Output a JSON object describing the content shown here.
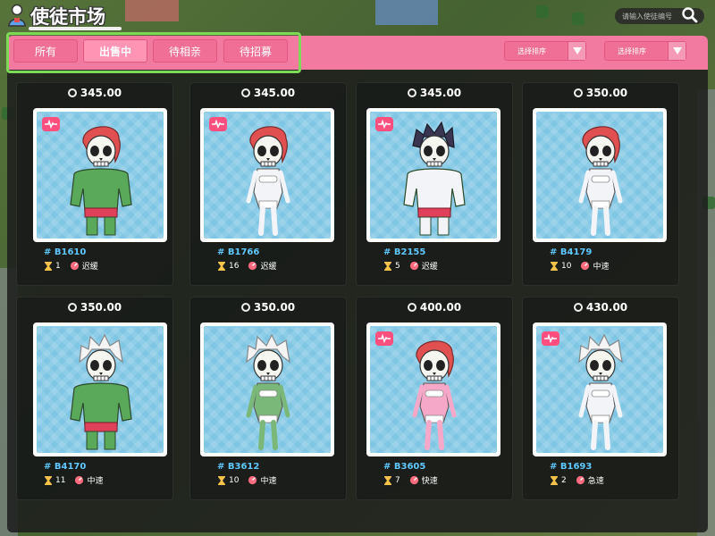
{
  "header": {
    "title": "使徒市场",
    "search_placeholder": "请输入使徒编号"
  },
  "tabs": [
    {
      "label": "所有",
      "active": false
    },
    {
      "label": "出售中",
      "active": true
    },
    {
      "label": "待相亲",
      "active": false
    },
    {
      "label": "待招募",
      "active": false
    }
  ],
  "sorts": [
    {
      "label": "选择排序"
    },
    {
      "label": "选择排序"
    }
  ],
  "colors": {
    "tab_bar": "#f27aa0",
    "selection_outline": "#7ed957",
    "id_text": "#5fc8ff",
    "heart": "#ff4f7e"
  },
  "cards": [
    {
      "price": "345.00",
      "id": "# B1610",
      "count": "1",
      "speed": "迟缓",
      "heart": true,
      "hair": "#e05050",
      "body": "#5aa85a",
      "hair_style": "red",
      "build": "muscle"
    },
    {
      "price": "345.00",
      "id": "# B1766",
      "count": "16",
      "speed": "迟缓",
      "heart": true,
      "hair": "#e05050",
      "body": "#f2f4f8",
      "hair_style": "red",
      "build": "slim"
    },
    {
      "price": "345.00",
      "id": "# B2155",
      "count": "5",
      "speed": "迟缓",
      "heart": true,
      "hair": "#3a3550",
      "body": "#f2f4f8",
      "hair_style": "dark",
      "build": "muscle"
    },
    {
      "price": "350.00",
      "id": "# B4179",
      "count": "10",
      "speed": "中速",
      "heart": false,
      "hair": "#e05050",
      "body": "#f2f4f8",
      "hair_style": "red",
      "build": "slim"
    },
    {
      "price": "350.00",
      "id": "# B4170",
      "count": "11",
      "speed": "中速",
      "heart": false,
      "hair": "#f4f4f4",
      "body": "#5aa85a",
      "hair_style": "white",
      "build": "muscle"
    },
    {
      "price": "350.00",
      "id": "# B3612",
      "count": "10",
      "speed": "中速",
      "heart": false,
      "hair": "#f4f4f4",
      "body": "#7ab87a",
      "hair_style": "white",
      "build": "slim"
    },
    {
      "price": "400.00",
      "id": "# B3605",
      "count": "7",
      "speed": "快速",
      "heart": true,
      "hair": "#e05050",
      "body": "#f5a8c8",
      "hair_style": "red",
      "build": "slim"
    },
    {
      "price": "430.00",
      "id": "# B1693",
      "count": "2",
      "speed": "急速",
      "heart": true,
      "hair": "#f4f4f4",
      "body": "#f2f4f8",
      "hair_style": "white",
      "build": "slim"
    }
  ]
}
